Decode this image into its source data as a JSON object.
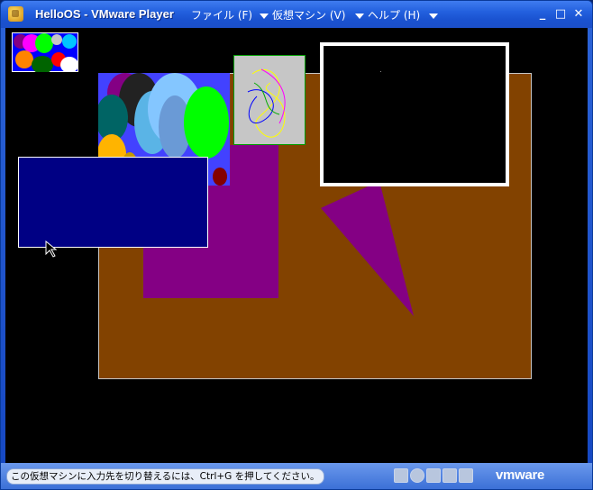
{
  "window": {
    "title": "HelloOS - VMware Player",
    "menus": [
      {
        "label": "ファイル (F)"
      },
      {
        "label": "仮想マシン (V)"
      },
      {
        "label": "ヘルプ (H)"
      }
    ],
    "controls": {
      "minimize": "_",
      "maximize": "□",
      "close": "✕"
    }
  },
  "status": {
    "hint": "この仮想マシンに入力先を切り替えるには、Ctrl+G を押してください。",
    "brand": "vmware",
    "devices": [
      "hard-disk-icon",
      "cd-icon",
      "floppy-icon",
      "network-icon",
      "sound-icon"
    ]
  },
  "colors": {
    "desktop": "#000000",
    "brown_sheet": "#824200",
    "purple": "#840084",
    "navy_window": "#000084",
    "gray_window": "#c6c6c6"
  }
}
